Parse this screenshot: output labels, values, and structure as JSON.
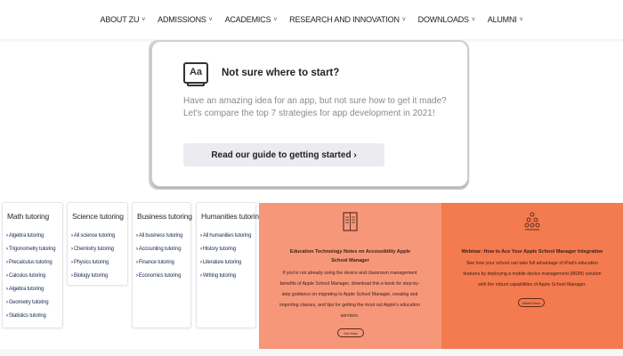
{
  "nav": {
    "items": [
      {
        "label": "ABOUT ZU",
        "dropdown": true
      },
      {
        "label": "ADMISSIONS",
        "dropdown": true
      },
      {
        "label": "ACADEMICS",
        "dropdown": true
      },
      {
        "label": "RESEARCH AND INNOVATION",
        "dropdown": true
      },
      {
        "label": "DOWNLOADS",
        "dropdown": true
      },
      {
        "label": "ALUMNI",
        "dropdown": true
      }
    ],
    "chevron": "˅"
  },
  "guide_card": {
    "icon_text": "Aa",
    "title": "Not sure where to start?",
    "text": "Have an amazing idea for an app, but not sure how to get it made? Let's compare the top 7 strategies for app development in 2021!",
    "button_label": "Read our guide to getting started ›"
  },
  "tutoring": [
    {
      "title": "Math tutoring",
      "links": [
        "Algebra tutoring",
        "Trigonometry tutoring",
        "Precalculus tutoring",
        "Calculus tutoring",
        "Algebra tutoring",
        "Geometry tutoring",
        "Statistics tutoring"
      ]
    },
    {
      "title": "Science tutoring",
      "links": [
        "All science tutoring",
        "Chemistry tutoring",
        "Physics tutoring",
        "Biology tutoring"
      ]
    },
    {
      "title": "Business tutoring",
      "links": [
        "All business tutoring",
        "Accounting tutoring",
        "Finance tutoring",
        "Economics tutoring"
      ]
    },
    {
      "title": "Humanities tutoring",
      "links": [
        "All humanities tutoring",
        "History tutoring",
        "Literature tutoring",
        "Writing tutoring"
      ]
    }
  ],
  "link_arrow": "›",
  "promos": [
    {
      "icon": "book-icon",
      "background": "#f6977a",
      "title": "Education Technology Notes on Accessibility Apple School Manager",
      "text": "If you're not already using the device and classroom management benefits of Apple School Manager, download this e-book for step-by-step guidance on migrating to Apple School Manager, creating and importing classes, and tips for getting the most out Apple's education services.",
      "button_label": "Get Now"
    },
    {
      "icon": "people-icon",
      "background": "#f47a4f",
      "title": "Webinar: How to Ace Your Apple School Manager Integration",
      "text": "See how your school can take full advantage of iPad's education features by deploying a mobile device management (MDM) solution with the robust capabilities of Apple School Manager.",
      "button_label": "Watch Now"
    }
  ]
}
